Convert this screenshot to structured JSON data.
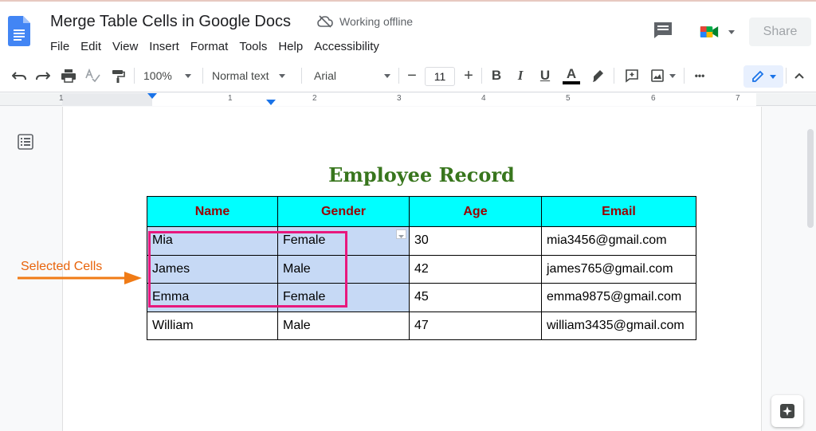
{
  "header": {
    "title": "Merge Table Cells in Google Docs",
    "status": "Working offline",
    "share_label": "Share",
    "menu": [
      "File",
      "Edit",
      "View",
      "Insert",
      "Format",
      "Tools",
      "Help",
      "Accessibility"
    ]
  },
  "toolbar": {
    "zoom": "100%",
    "style": "Normal text",
    "font": "Arial",
    "font_size": "11",
    "minus": "−",
    "plus": "+",
    "bold": "B",
    "italic": "I",
    "underline": "U",
    "text_color": "A",
    "more": "•••"
  },
  "ruler": {
    "labels": [
      "1",
      "1",
      "2",
      "3",
      "4",
      "5",
      "6",
      "7"
    ]
  },
  "document": {
    "heading": "Employee Record",
    "table": {
      "headers": [
        "Name",
        "Gender",
        "Age",
        "Email"
      ],
      "rows": [
        [
          "Mia",
          "Female",
          "30",
          "mia3456@gmail.com"
        ],
        [
          "James",
          "Male",
          "42",
          "james765@gmail.com"
        ],
        [
          "Emma",
          "Female",
          "45",
          "emma9875@gmail.com"
        ],
        [
          "William",
          "Male",
          "47",
          "william3435@gmail.com"
        ]
      ]
    },
    "annotation": "Selected Cells"
  },
  "colors": {
    "heading": "#38761d",
    "table_header_bg": "#00ffff",
    "table_header_text": "#990000",
    "selection": "#c6d9f5",
    "highlight_border": "#e8187d",
    "annotation": "#e8630a"
  }
}
